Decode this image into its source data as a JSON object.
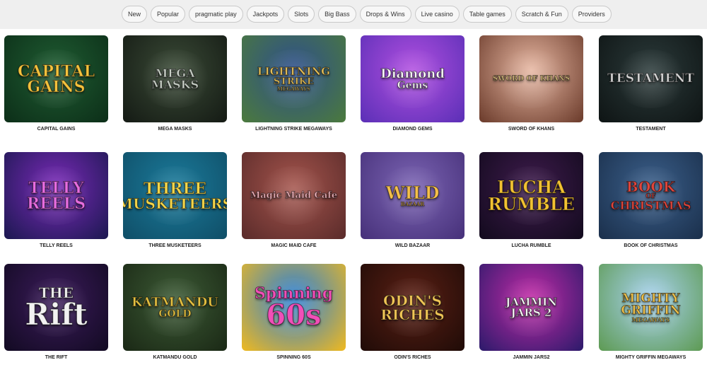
{
  "filters": [
    {
      "label": "New"
    },
    {
      "label": "Popular"
    },
    {
      "label": "pragmatic play"
    },
    {
      "label": "Jackpots"
    },
    {
      "label": "Slots"
    },
    {
      "label": "Big Bass"
    },
    {
      "label": "Drops & Wins"
    },
    {
      "label": "Live casino"
    },
    {
      "label": "Table games"
    },
    {
      "label": "Scratch & Fun"
    },
    {
      "label": "Providers"
    }
  ],
  "games": [
    {
      "title": "CAPITAL GAINS",
      "logo_line1": "CAPITAL",
      "logo_line2": "GAINS",
      "colors": {
        "bg1": "#1f5c32",
        "bg2": "#0c2e18",
        "text": "#f4c23d"
      }
    },
    {
      "title": "MEGA MASKS",
      "logo_line1": "MEGA",
      "logo_line2": "MASKS",
      "colors": {
        "bg1": "#3a4a36",
        "bg2": "#141a14",
        "text": "#c9d0c7"
      }
    },
    {
      "title": "LIGHTNING STRIKE MEGAWAYS",
      "logo_line1": "LIGHTNING",
      "logo_line2": "STRIKE",
      "logo_line3": "MEGAWAYS",
      "colors": {
        "bg1": "#2e4f8c",
        "bg2": "#4b7a3c",
        "text": "#e9c25a"
      }
    },
    {
      "title": "DIAMOND GEMS",
      "logo_line1": "Diamond",
      "logo_line2": "Gems",
      "colors": {
        "bg1": "#b14fe0",
        "bg2": "#5a2fb6",
        "text": "#ffffff"
      }
    },
    {
      "title": "SWORD OF KHANS",
      "logo_line1": "SWORD OF KHANS",
      "colors": {
        "bg1": "#e7b7a2",
        "bg2": "#6a3a2a",
        "text": "#f0d58a"
      }
    },
    {
      "title": "TESTAMENT",
      "logo_line1": "TESTAMENT",
      "colors": {
        "bg1": "#2b3a3a",
        "bg2": "#0e1414",
        "text": "#d8d8d8"
      }
    },
    {
      "title": "TELLY REELS",
      "logo_line1": "TELLY",
      "logo_line2": "REELS",
      "colors": {
        "bg1": "#7a2ab8",
        "bg2": "#1b1850",
        "text": "#e76de0"
      }
    },
    {
      "title": "THREE MUSKETEERS",
      "logo_line1": "THREE",
      "logo_line2": "MUSKETEERS",
      "colors": {
        "bg1": "#1b7a9a",
        "bg2": "#0f4e67",
        "text": "#f5d64a"
      }
    },
    {
      "title": "MAGIC MAID CAFE",
      "logo_line1": "Magic Maid Cafe",
      "colors": {
        "bg1": "#a4544c",
        "bg2": "#5a2b2a",
        "text": "#f6b7c0"
      }
    },
    {
      "title": "WILD BAZAAR",
      "logo_line1": "WILD",
      "logo_line2": "BAZAAR",
      "colors": {
        "bg1": "#7b64b3",
        "bg2": "#463079",
        "text": "#f5c04a"
      }
    },
    {
      "title": "LUCHA RUMBLE",
      "logo_line1": "LUCHA",
      "logo_line2": "RUMBLE",
      "colors": {
        "bg1": "#3e1b4c",
        "bg2": "#120a1d",
        "text": "#f2c232"
      }
    },
    {
      "title": "BOOK OF CHRISTMAS",
      "logo_line1": "BOOK",
      "logo_line2": "OF",
      "logo_line3": "CHRISTMAS",
      "colors": {
        "bg1": "#3b5f8a",
        "bg2": "#1a2f4b",
        "text": "#e0463c"
      }
    },
    {
      "title": "THE RIFT",
      "logo_line1": "THE",
      "logo_line2": "Rift",
      "colors": {
        "bg1": "#3b1b5a",
        "bg2": "#120a22",
        "text": "#f2f2f2"
      }
    },
    {
      "title": "KATMANDU GOLD",
      "logo_line1": "KATMANDU",
      "logo_line2": "GOLD",
      "colors": {
        "bg1": "#3c5a35",
        "bg2": "#1a2815",
        "text": "#e5c041"
      }
    },
    {
      "title": "SPINNING 60S",
      "logo_line1": "Spinning",
      "logo_line2": "60s",
      "colors": {
        "bg1": "#2a7fd8",
        "bg2": "#f0b91e",
        "text": "#f14fb8"
      }
    },
    {
      "title": "ODIN'S RICHES",
      "logo_line1": "ODIN'S",
      "logo_line2": "RICHES",
      "colors": {
        "bg1": "#5a1f14",
        "bg2": "#1f0b07",
        "text": "#f0c556"
      }
    },
    {
      "title": "JAMMIN JARS2",
      "logo_line1": "JAMMIN",
      "logo_line2": "JARS 2",
      "colors": {
        "bg1": "#c12aa6",
        "bg2": "#2b1a6a",
        "text": "#ffffff"
      }
    },
    {
      "title": "MIGHTY GRIFFIN MEGAWAYS",
      "logo_line1": "MIGHTY",
      "logo_line2": "GRIFFIN",
      "logo_line3": "MEGAWAYS",
      "colors": {
        "bg1": "#a8d2f0",
        "bg2": "#5d9a52",
        "text": "#f0c24b"
      }
    }
  ]
}
